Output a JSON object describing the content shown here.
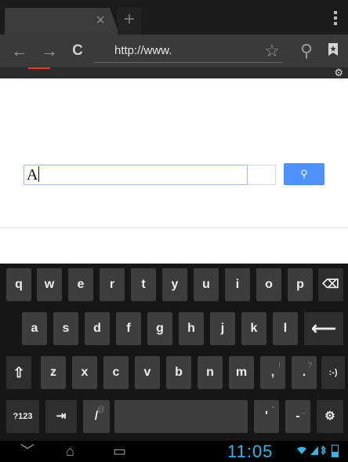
{
  "browser": {
    "tab": {
      "close_glyph": "×",
      "new_tab_glyph": "+"
    },
    "toolbar": {
      "back_glyph": "←",
      "forward_glyph": "→",
      "reload_glyph": "C",
      "url": "http://www.",
      "star_glyph": "☆",
      "search_glyph": "⚲",
      "bookmarks_icon": "bookmark-icon"
    },
    "settings_glyph": "⚙"
  },
  "page": {
    "search_value": "A",
    "search_button_glyph": "⚲"
  },
  "keyboard": {
    "row1": [
      "q",
      "w",
      "e",
      "r",
      "t",
      "y",
      "u",
      "i",
      "o",
      "p",
      "⌫"
    ],
    "row2": [
      "a",
      "s",
      "d",
      "f",
      "g",
      "h",
      "j",
      "k",
      "l",
      "⟵"
    ],
    "row3": [
      "⇧",
      "z",
      "x",
      "c",
      "v",
      "b",
      "n",
      "m",
      ",",
      ".",
      ":-)"
    ],
    "row3_hints": {
      "comma": "!",
      "period": "?"
    },
    "row4": {
      "symbols": "?123",
      "tab": "⇥",
      "slash": "/",
      "slash_hint": "@",
      "apostrophe": "'",
      "apostrophe_hint": "\"",
      "dash": "-",
      "dash_hint": "_",
      "settings": "⚙"
    }
  },
  "navbar": {
    "back_glyph": "﹀",
    "home_glyph": "⌂",
    "recents_glyph": "▭",
    "time": "11:05"
  }
}
